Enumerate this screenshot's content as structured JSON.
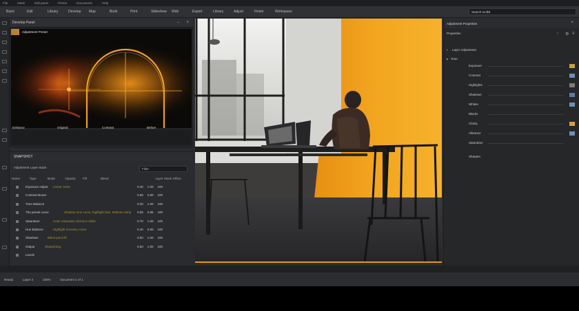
{
  "menubar": {
    "items": [
      "File",
      "Mask",
      "Edit panel",
      "Preset",
      "Documents",
      "Help"
    ]
  },
  "tabs": [
    "Basic",
    "Edit",
    "Library",
    "Develop",
    "Map",
    "Book",
    "Print",
    "Slideshow",
    "Web",
    "Export",
    "Library",
    "Adjust",
    "Finish",
    "Workspace"
  ],
  "search": {
    "value": "Search toolkit"
  },
  "panelA": {
    "title": "Develop Panel",
    "preview_title": "Adjustment Preset",
    "thumb_labels": [
      "Enhance",
      "Original",
      "Contrast",
      "Before"
    ]
  },
  "panelB": {
    "title": "SNAPSHOT",
    "subtitle": "Adjustment Layer Stack",
    "filter_value": "Filter",
    "columns": [
      "Name",
      "Type",
      "Mode",
      "Opacity",
      "Fill",
      "Blend",
      "Layer Stack",
      "Effect"
    ],
    "rows": [
      {
        "name": "Exposure Adjust",
        "desc": "Linear curve",
        "vals": [
          "0.45",
          "1.00",
          "100"
        ]
      },
      {
        "name": "Contrast Boost",
        "desc": "",
        "vals": [
          "0.65",
          "0.80",
          "100"
        ]
      },
      {
        "name": "Tone Balance",
        "desc": "",
        "vals": [
          "0.30",
          "1.00",
          "100"
        ]
      },
      {
        "name": "The preset curve",
        "desc": "Shadow tone curve, highlight bias, Midtone ramp",
        "vals": [
          "0.55",
          "0.95",
          "100"
        ]
      },
      {
        "name": "Saturation",
        "desc": "Color saturation vibrance slider",
        "vals": [
          "0.70",
          "1.00",
          "100"
        ]
      },
      {
        "name": "Hue Balance",
        "desc": "Highlight recovery curve",
        "vals": [
          "0.40",
          "0.90",
          "100"
        ]
      },
      {
        "name": "Shadows",
        "desc": "Black point lift",
        "vals": [
          "0.60",
          "1.00",
          "100"
        ]
      },
      {
        "name": "Output",
        "desc": "Sharpening",
        "vals": [
          "0.50",
          "1.00",
          "100"
        ]
      },
      {
        "name": "Levels",
        "desc": "",
        "vals": [
          "",
          "",
          ""
        ]
      }
    ]
  },
  "footer": {
    "items": [
      "Ready",
      "Layer 4",
      "100%",
      "Document 1 of 1"
    ]
  },
  "rpanel": {
    "title": "Adjustment Properties",
    "toolbar_label": "Properties",
    "section": "Layer Adjustment",
    "group_label": "Tone",
    "props": [
      {
        "label": "Exposure",
        "color": "#c7a53b"
      },
      {
        "label": "Contrast",
        "color": "#6f8fb8"
      },
      {
        "label": "Highlights",
        "color": "#7c7c7c"
      },
      {
        "label": "Shadows",
        "color": "#5d7aa6"
      },
      {
        "label": "Whites",
        "color": "#6f8fb8"
      },
      {
        "label": "Blacks",
        "color": "#"
      },
      {
        "label": "Clarity",
        "color": "#d9a13a"
      },
      {
        "label": "Vibrance",
        "color": "#6f8fb8"
      },
      {
        "label": "Saturation",
        "color": "#"
      },
      {
        "label": "Sharpen",
        "color": "#"
      }
    ]
  },
  "colors": {
    "accent": "#e69a1a",
    "panel": "#2a2b2d",
    "wall_orange": "#f0a722"
  }
}
